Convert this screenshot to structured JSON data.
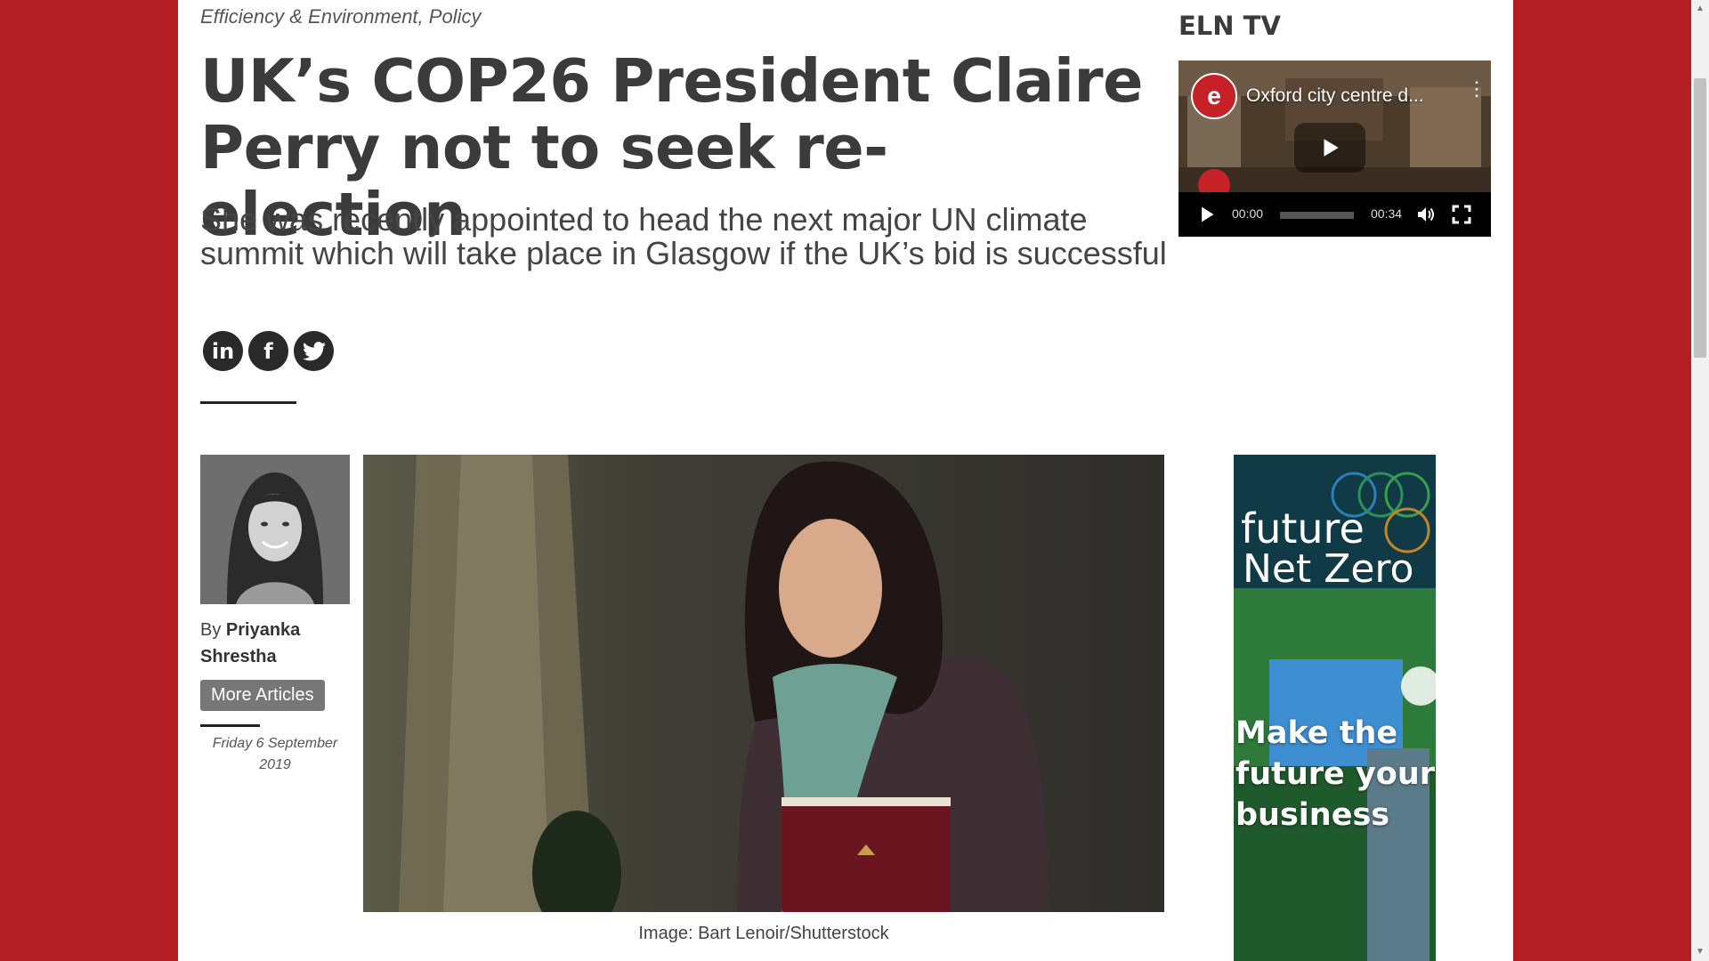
{
  "article": {
    "category": "Efficiency & Environment, Policy",
    "title": "UK’s COP26 President Claire Perry not to seek re-election",
    "subtitle": "She was recently appointed to head the next major UN climate summit which will take place in Glasgow if the UK’s bid is successful",
    "share": [
      {
        "icon": "linkedin-icon",
        "glyph": "in"
      },
      {
        "icon": "facebook-icon",
        "glyph": "f"
      },
      {
        "icon": "twitter-icon",
        "glyph": "🐦"
      }
    ],
    "author": {
      "by": "By",
      "name": "Priyanka Shrestha",
      "more_label": "More Articles"
    },
    "date": "Friday 6 September 2019",
    "image_caption": "Image: Bart Lenoir/Shutterstock"
  },
  "sidebar": {
    "eln_tv_title": "ELN TV",
    "video": {
      "title": "Oxford city centre d...",
      "current_time": "00:00",
      "duration": "00:34",
      "progress": 0
    },
    "ad": {
      "brand_line1": "future",
      "brand_line2": "Net Zero",
      "tagline": "Make the future your business"
    }
  },
  "colors": {
    "page_bg": "#b31e25",
    "content_bg": "#ffffff",
    "heading": "#3b3b3b",
    "button_grey": "#777777"
  }
}
